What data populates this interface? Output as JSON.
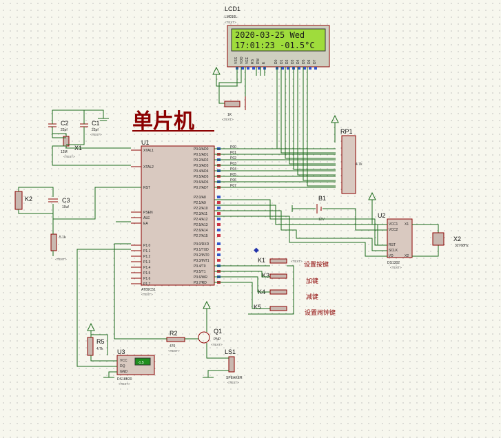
{
  "title": "单片机",
  "lcd": {
    "ref": "LCD1",
    "part": "LM016L",
    "line1": "2020-03-25 Wed",
    "line2": "17:01:23 -01.5°C",
    "pins": [
      "VSS",
      "VDD",
      "VEE",
      "RS",
      "RW",
      "E",
      "D0",
      "D1",
      "D2",
      "D3",
      "D4",
      "D5",
      "D6",
      "D7"
    ]
  },
  "mcu": {
    "ref": "U1",
    "part": "AT89C51",
    "left_pins": [
      "XTAL1",
      "XTAL2",
      "RST",
      "PSEN",
      "ALE",
      "EA",
      "P1.0",
      "P1.1",
      "P1.2",
      "P1.3",
      "P1.4",
      "P1.5",
      "P1.6",
      "P1.7"
    ],
    "right_pins": [
      "P0.0/AD0",
      "P0.1/AD1",
      "P0.2/AD2",
      "P0.3/AD3",
      "P0.4/AD4",
      "P0.5/AD5",
      "P0.6/AD6",
      "P0.7/AD7",
      "P2.0/A8",
      "P2.1/A9",
      "P2.2/A10",
      "P2.3/A11",
      "P2.4/A12",
      "P2.5/A13",
      "P2.6/A14",
      "P2.7/A15",
      "P3.0/RXD",
      "P3.1/TXD",
      "P3.2/INT0",
      "P3.3/INT1",
      "P3.4/T0",
      "P3.5/T1",
      "P3.6/WR",
      "P3.7/RD"
    ],
    "net_labels": [
      "P00",
      "P01",
      "P02",
      "P03",
      "P04",
      "P05",
      "P06",
      "P07"
    ]
  },
  "caps": [
    {
      "ref": "C2",
      "value": "22pf"
    },
    {
      "ref": "C1",
      "value": "22pf"
    },
    {
      "ref": "C3",
      "value": "10uf"
    }
  ],
  "crystal": {
    "ref": "X1",
    "value": "12M"
  },
  "rp": {
    "ref": "RP1",
    "value": "4.7k"
  },
  "pot": {
    "value": "1K"
  },
  "resistors": [
    {
      "ref": "R2",
      "value": "470"
    },
    {
      "ref": "R5",
      "value": "4.7k"
    },
    {
      "ref": "",
      "value": "5.1k"
    }
  ],
  "rtc": {
    "ref": "U2",
    "part": "DS1302",
    "pins_l": [
      "VCC1",
      "VCC2",
      "RST",
      "SCLK",
      "I/O"
    ],
    "pins_r": [
      "X1",
      "X2"
    ]
  },
  "x2": {
    "ref": "X2",
    "value": "32768Hz"
  },
  "battery": {
    "ref": "B1",
    "value": "12V"
  },
  "keys": [
    {
      "ref": "K1",
      "label": "设置按键"
    },
    {
      "ref": "K3",
      "label": "加键"
    },
    {
      "ref": "K4",
      "label": "减键"
    },
    {
      "ref": "K5",
      "label": "设置闹钟键"
    }
  ],
  "k2": {
    "ref": "K2"
  },
  "q1": {
    "ref": "Q1",
    "type": "PNP"
  },
  "ls1": {
    "ref": "LS1",
    "type": "SPEAKER"
  },
  "u3": {
    "ref": "U3",
    "part": "DS18B20",
    "pins": [
      "VCC",
      "DQ",
      "GND"
    ],
    "display": "-1.5"
  },
  "text_placeholder": "<TEXT>"
}
